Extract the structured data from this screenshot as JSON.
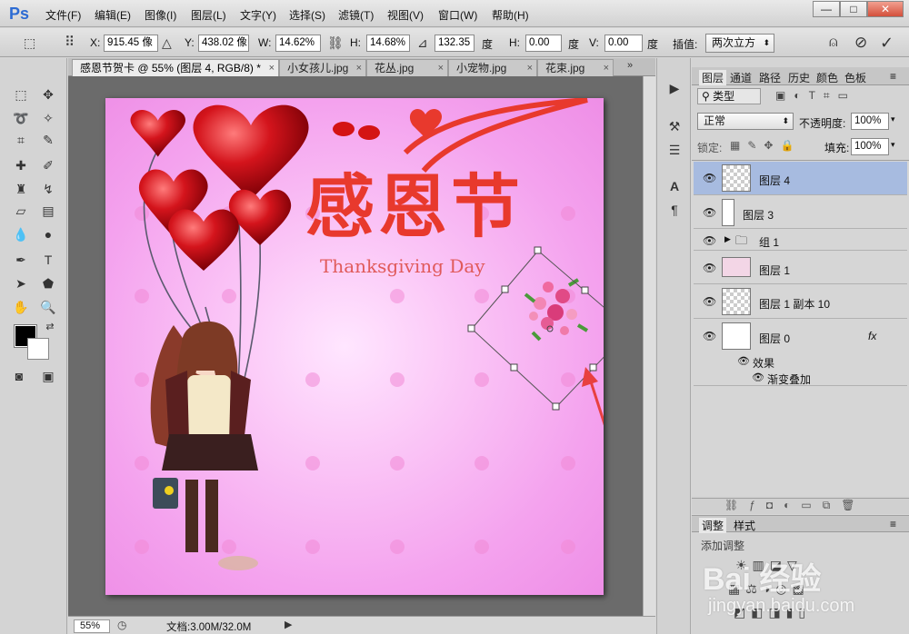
{
  "app": {
    "logo": "Ps"
  },
  "menu": [
    "文件(F)",
    "编辑(E)",
    "图像(I)",
    "图层(L)",
    "文字(Y)",
    "选择(S)",
    "滤镜(T)",
    "视图(V)",
    "窗口(W)",
    "帮助(H)"
  ],
  "window_buttons": {
    "minimize": "—",
    "maximize": "□",
    "close": "✕"
  },
  "options": {
    "x_label": "X:",
    "x_value": "915.45 像",
    "y_label": "Y:",
    "y_value": "438.02 像",
    "w_label": "W:",
    "w_value": "14.62%",
    "h_label": "H:",
    "h_value": "14.68%",
    "angle_value": "132.35",
    "angle_unit": "度",
    "hskew_label": "H:",
    "hskew_value": "0.00",
    "hskew_unit": "度",
    "vskew_label": "V:",
    "vskew_value": "0.00",
    "vskew_unit": "度",
    "interp_label": "插值:",
    "interp_value": "两次立方"
  },
  "doc_tabs": [
    {
      "label": "感恩节贺卡 @ 55% (图层 4, RGB/8) *",
      "active": true
    },
    {
      "label": "小女孩儿.jpg",
      "active": false
    },
    {
      "label": "花丛.jpg",
      "active": false
    },
    {
      "label": "小宠物.jpg",
      "active": false
    },
    {
      "label": "花束.jpg",
      "active": false
    }
  ],
  "canvas": {
    "title": "感恩节",
    "subtitle": "Thanksgiving Day"
  },
  "status": {
    "zoom": "55%",
    "doc": "文档:3.00M/32.0M"
  },
  "panel_tabs": [
    "图层",
    "通道",
    "路径",
    "历史",
    "颜色",
    "色板"
  ],
  "layers_panel": {
    "filter_kind": "类型",
    "blend_mode": "正常",
    "opacity_label": "不透明度:",
    "opacity_value": "100%",
    "lock_label": "锁定:",
    "fill_label": "填充:",
    "fill_value": "100%"
  },
  "layers": [
    {
      "name": "图层 4",
      "selected": true
    },
    {
      "name": "图层 3",
      "selected": false
    },
    {
      "name": "组 1",
      "selected": false
    },
    {
      "name": "图层 1",
      "selected": false
    },
    {
      "name": "图层 1 副本 10",
      "selected": false
    },
    {
      "name": "图层 0",
      "selected": false,
      "fx": "fx",
      "effects_label": "效果",
      "effect": "渐变叠加"
    }
  ],
  "adjust_panel": {
    "tabs": [
      "调整",
      "样式"
    ],
    "hint": "添加调整"
  },
  "watermark": {
    "brand": "Bai 经验",
    "url": "jingyan.baidu.com"
  },
  "colors": {
    "accent": "#2d6bd3",
    "selection": "#a7bbe0",
    "canvas_pink": "#f4a2ee",
    "title_red": "#e8392d"
  }
}
